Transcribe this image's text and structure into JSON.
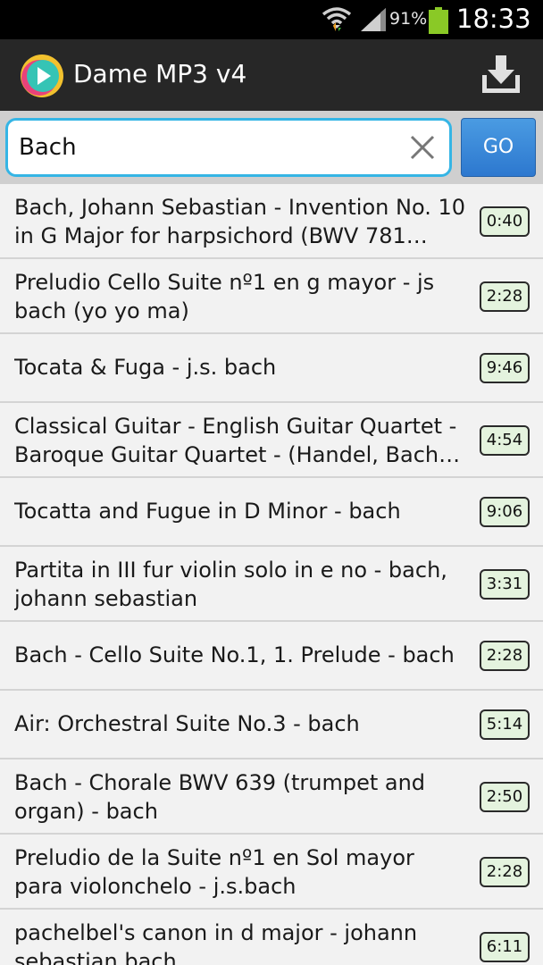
{
  "status_bar": {
    "battery_percent": "91%",
    "time": "18:33"
  },
  "app_bar": {
    "title": "Dame MP3 v4"
  },
  "search": {
    "value": "Bach",
    "go_label": "GO"
  },
  "results": [
    {
      "title": "Bach, Johann Sebastian - Invention No. 10 in G Major for harpsichord (BWV 781…",
      "duration": "0:40"
    },
    {
      "title": "Preludio Cello Suite nº1 en g mayor - js bach (yo yo ma)",
      "duration": "2:28"
    },
    {
      "title": "Tocata & Fuga - j.s. bach",
      "duration": "9:46"
    },
    {
      "title": "Classical Guitar - English Guitar Quartet - Baroque Guitar Quartet - (Handel, Bach…",
      "duration": "4:54"
    },
    {
      "title": "Tocatta and Fugue in D Minor - bach",
      "duration": "9:06"
    },
    {
      "title": "Partita in III fur violin solo in e no - bach, johann sebastian",
      "duration": "3:31"
    },
    {
      "title": "Bach - Cello Suite No.1, 1. Prelude - bach",
      "duration": "2:28"
    },
    {
      "title": "Air: Orchestral Suite No.3 - bach",
      "duration": "5:14"
    },
    {
      "title": "Bach - Chorale BWV 639 (trumpet and organ) - bach",
      "duration": "2:50"
    },
    {
      "title": "Preludio de la Suite nº1 en Sol mayor para violonchelo - j.s.bach",
      "duration": "2:28"
    },
    {
      "title": "pachelbel's canon in d major - johann sebastian bach",
      "duration": "6:11"
    }
  ]
}
